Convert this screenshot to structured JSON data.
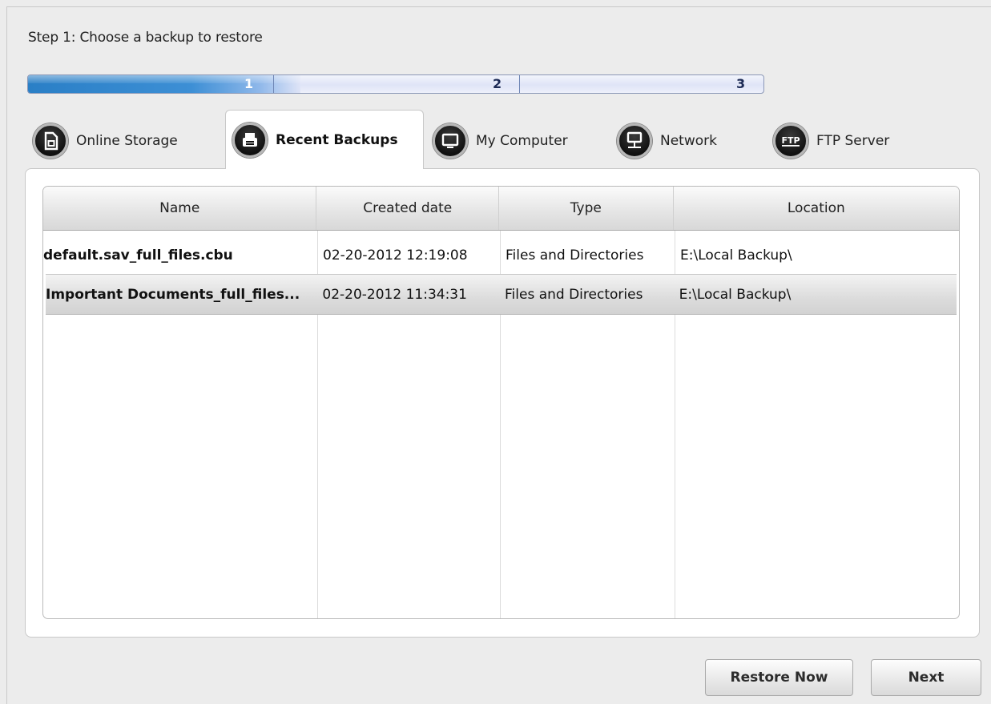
{
  "step_title": "Step 1: Choose a backup to restore",
  "progress": {
    "steps": [
      "1",
      "2",
      "3"
    ],
    "current_step": 1,
    "fill_fraction": 0.37
  },
  "tabs": [
    {
      "label": "Online Storage",
      "icon": "online-storage-icon",
      "active": false
    },
    {
      "label": "Recent Backups",
      "icon": "recent-backups-icon",
      "active": true
    },
    {
      "label": "My Computer",
      "icon": "monitor-icon",
      "active": false
    },
    {
      "label": "Network",
      "icon": "network-icon",
      "active": false
    },
    {
      "label": "FTP Server",
      "icon": "ftp-icon",
      "active": false
    }
  ],
  "table": {
    "columns": [
      "Name",
      "Created date",
      "Type",
      "Location"
    ],
    "rows": [
      {
        "name": "default.sav_full_files.cbu",
        "created": "02-20-2012 12:19:08",
        "type": "Files and Directories",
        "location": "E:\\Local Backup\\",
        "selected": false
      },
      {
        "name": "Important Documents_full_files...",
        "created": "02-20-2012 11:34:31",
        "type": "Files and Directories",
        "location": "E:\\Local Backup\\",
        "selected": true
      }
    ]
  },
  "buttons": {
    "restore_now": "Restore Now",
    "next": "Next"
  }
}
